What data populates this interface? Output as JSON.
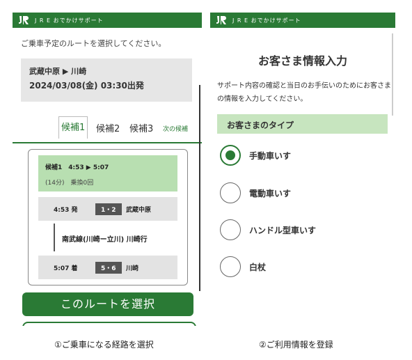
{
  "left": {
    "app_title": "J R E おでかけサポート",
    "lead": "ご乗車予定のルートを選択してください。",
    "route_stations": "武蔵中原 ▶ 川崎",
    "route_datetime": "2024/03/08(金) 03:30出発",
    "tabs": [
      "候補1",
      "候補2",
      "候補3"
    ],
    "next_link": "次の候補",
    "summary": {
      "head": "候補1　4:53 ▶ 5:07",
      "duration": "(14分)　乗換0回"
    },
    "depart": {
      "time": "4:53 発",
      "platform": "1・2",
      "station": "武蔵中原"
    },
    "line": "南武線(川崎ー立川) 川崎行",
    "arrive": {
      "time": "5:07 着",
      "platform": "5・6",
      "station": "川崎"
    },
    "select_button": "このルートを選択",
    "caption": "①ご乗車になる経路を選択"
  },
  "right": {
    "app_title": "J R E おでかけサポート",
    "title": "お客さま情報入力",
    "desc": "サポート内容の確認と当日のお手伝いのためにお客さまの情報を入力してください。",
    "type_header": "お客さまのタイプ",
    "options": [
      "手動車いす",
      "電動車いす",
      "ハンドル型車いす",
      "白杖"
    ],
    "selected_option": "手動車いす",
    "caption": "②ご利用情報を登録"
  },
  "colors": {
    "brand_green": "#2a7a35",
    "light_green": "#b8dfb1"
  }
}
